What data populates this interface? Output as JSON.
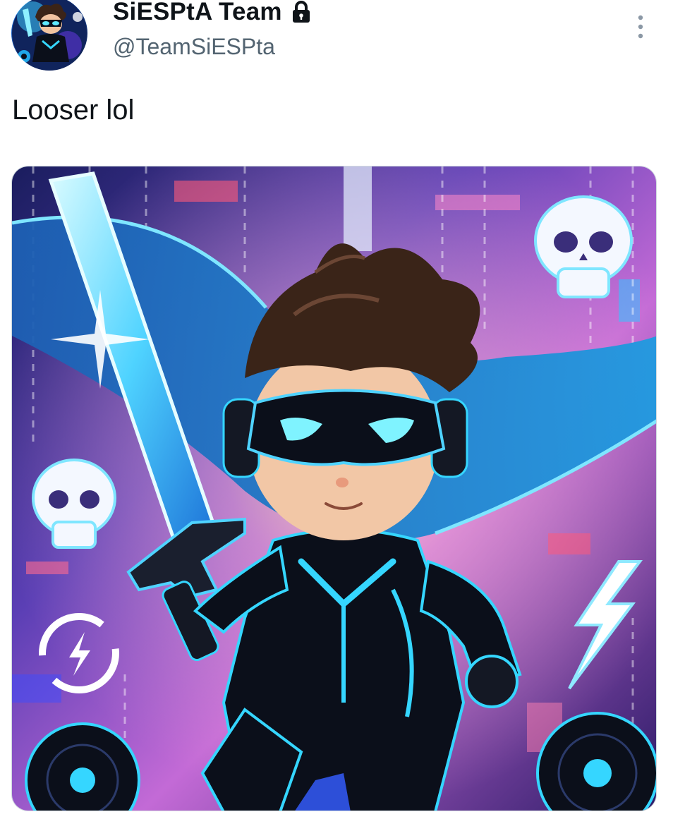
{
  "tweet": {
    "author": {
      "display_name": "SiESPtA Team",
      "handle": "@TeamSiESPta",
      "protected_icon": "lock-icon",
      "avatar_icon": "avatar-hero"
    },
    "text": "Looser lol",
    "more_icon": "more-vertical-icon",
    "media": {
      "kind": "image",
      "description_icon": "cyber-hero-illustration"
    }
  },
  "colors": {
    "text_primary": "#0f1419",
    "text_secondary": "#536471",
    "accent_cyan": "#35d6ff"
  }
}
